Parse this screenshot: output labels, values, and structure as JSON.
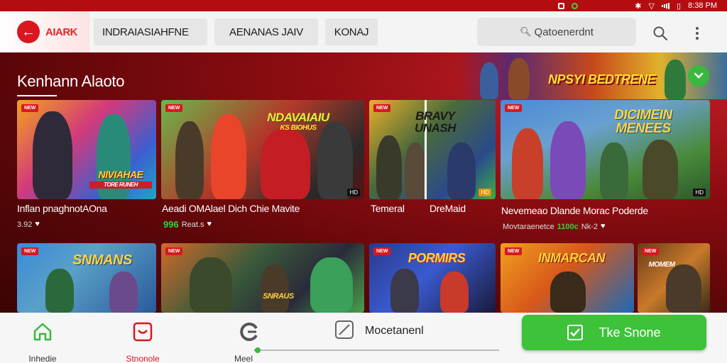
{
  "status_bar": {
    "time": "8:38 PM"
  },
  "header": {
    "back_label": "AIARK",
    "tabs": [
      {
        "label": "INDRAIASIAHFNE"
      },
      {
        "label": "AENANAS JAIV"
      },
      {
        "label": "KONAJ"
      }
    ],
    "search": {
      "label": "Qatoenerdnt",
      "icon": "search-icon"
    },
    "menu_icon": "kebab-menu-icon"
  },
  "hero": {
    "section_title": "Kenhann Alaoto",
    "banner_title": "NPSYI BEDTRENE"
  },
  "cards_row1": [
    {
      "tag": "NEW",
      "logo": "NIVIAHAE",
      "logo_sub": "TORE RUNEH",
      "title": "Inflan pnaghnotAOna",
      "rating": "3.92",
      "price": ""
    },
    {
      "tag": "NEW",
      "logo": "NDAVAIAIU",
      "logo_sub": "KS BIOHUS",
      "corner": "HD",
      "title": "Aeadi OMAlael Dich Chie Mavite",
      "rating": "",
      "price": "996",
      "price_note": "Reat.s"
    },
    {
      "tag": "NEW",
      "logo": "BRAVY\nUNASH",
      "corner": "HD",
      "title": "Temeral",
      "title2": "DreMaid"
    },
    {
      "tag": "NEW",
      "logo": "DICIMEIN\nMENEES",
      "corner": "HD",
      "title": "Nevemeao Dlande Morac Poderde",
      "meta": "Movtaraenetce",
      "price": "1100c",
      "price_note": "Nk-2"
    }
  ],
  "cards_row2": [
    {
      "tag": "NEW",
      "logo": "SNMANS"
    },
    {
      "tag": "NEW",
      "logo": "SNRAUS"
    },
    {
      "tag": "NEW",
      "logo": "PORMIRS"
    },
    {
      "tag": "NEW",
      "logo": "INMARCAN"
    },
    {
      "tag": "NEW",
      "logo": "MOMEM"
    }
  ],
  "bottom_nav": {
    "home_label": "Inhedie",
    "alerts_label": "Stnonole",
    "mail_label": "Meel",
    "mode_label": "Mocetanenl",
    "cta_label": "Tke Snone",
    "progress_fraction": 0.01
  },
  "colors": {
    "brand_red": "#d8181e",
    "accent_green": "#3ec23a"
  }
}
